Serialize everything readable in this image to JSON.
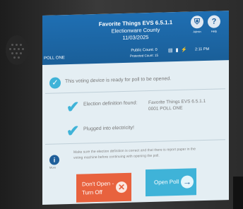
{
  "header": {
    "system_name": "Favorite Things EVS  6.5.1.1",
    "county": "Electionware County",
    "date": "11/03/2025",
    "poll_name": "POLL ONE",
    "public_count": "Public Count: 0",
    "protected_count": "Protected Count: 15",
    "admin_label": "Admin",
    "help_label": "Help",
    "clock": "2:11 PM",
    "admin_icon": "shield-icon",
    "help_icon": "question-icon"
  },
  "content": {
    "ready_message": "This voting device is ready for poll to be opened.",
    "definition_label": "Election definition found:",
    "definition_value_line1": "Favorite Things EVS  6.5.1.1",
    "definition_value_line2": "0001 POLL ONE",
    "electricity_label": "Plugged into electricity!",
    "info_label": "More",
    "warning_line1": "Make sure the election definition is correct and that there is report paper in the",
    "warning_line2": "voting machine before continuing with opening the poll."
  },
  "buttons": {
    "dont_open_line1": "Don't Open -",
    "dont_open_line2": "Turn Off",
    "open_poll": "Open Poll"
  },
  "colors": {
    "header_blue": "#1f6fb3",
    "accent_cyan": "#3fb3d8",
    "cancel_orange": "#e8623e",
    "screen_bg": "#e4eef3"
  }
}
